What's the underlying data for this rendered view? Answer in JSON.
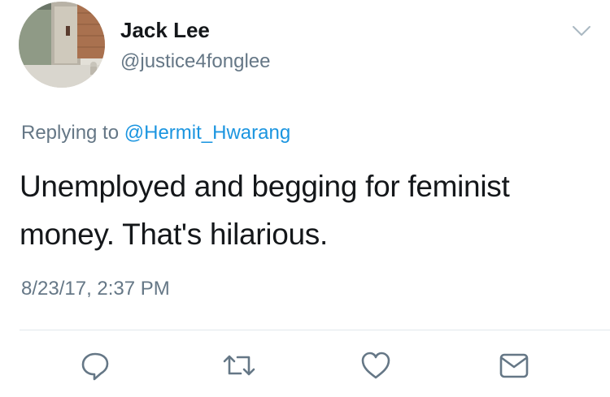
{
  "tweet": {
    "author": {
      "display_name": "Jack Lee",
      "handle": "@justice4fonglee"
    },
    "reply": {
      "prefix": "Replying to",
      "mention": "@Hermit_Hwarang"
    },
    "text": "Unemployed and begging for feminist money. That's hilarious.",
    "timestamp": "8/23/17, 2:37 PM"
  },
  "actions": [
    {
      "icon": "reply-icon"
    },
    {
      "icon": "retweet-icon"
    },
    {
      "icon": "like-icon"
    },
    {
      "icon": "direct-message-icon"
    }
  ],
  "colors": {
    "name": "#14171a",
    "secondary": "#657786",
    "link": "#1b95e0",
    "divider": "#e1e8ed",
    "icon": "#657786"
  }
}
